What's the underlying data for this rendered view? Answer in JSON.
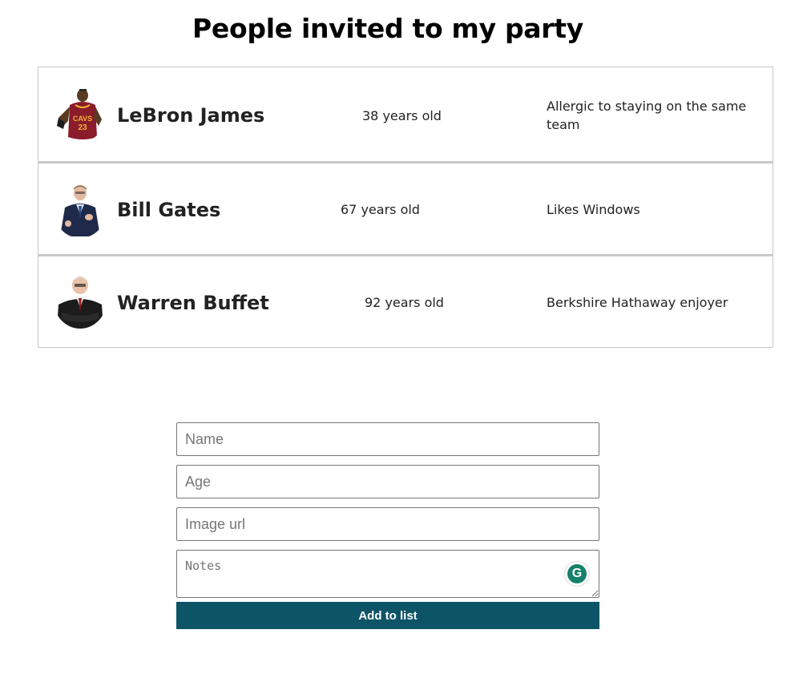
{
  "title": "People invited to my party",
  "guests": [
    {
      "name": "LeBron James",
      "age": "38 years old",
      "note": "Allergic to staying on the same team",
      "avatar_icon": "lebron-james-photo-icon"
    },
    {
      "name": "Bill Gates",
      "age": "67 years old",
      "note": "Likes Windows",
      "avatar_icon": "bill-gates-photo-icon"
    },
    {
      "name": "Warren Buffet",
      "age": "92 years old",
      "note": "Berkshire Hathaway enjoyer",
      "avatar_icon": "warren-buffet-photo-icon"
    }
  ],
  "form": {
    "name_placeholder": "Name",
    "age_placeholder": "Age",
    "image_placeholder": "Image url",
    "notes_placeholder": "Notes",
    "submit_label": "Add to list",
    "grammarly_icon": "grammarly-icon",
    "grammarly_letter": "G"
  },
  "colors": {
    "button_bg": "#0d5466",
    "grammarly": "#15826b",
    "border": "#c8c8c8"
  }
}
